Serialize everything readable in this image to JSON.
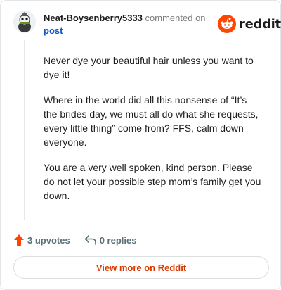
{
  "header": {
    "username": "Neat-Boysenberry5333",
    "commented_on": "commented on",
    "post_link": "post"
  },
  "brand": {
    "wordmark": "reddit",
    "color": "#ff4500"
  },
  "comment": {
    "paragraphs": [
      "Never dye your beautiful hair unless you want to dye it!",
      "Where in the world did all this nonsense of “It’s the brides day, we must all do what she requests, every little thing” come from? FFS, calm down everyone.",
      "You are a very well spoken, kind person. Please do not let your possible step mom’s family get you down."
    ]
  },
  "actions": {
    "upvotes_label": "3 upvotes",
    "replies_label": "0 replies"
  },
  "footer": {
    "view_more_label": "View more on Reddit"
  },
  "icons": {
    "avatar": "avatar",
    "brand": "reddit-snoo-icon",
    "upvote": "upvote-arrow-icon",
    "reply": "reply-arrow-icon"
  }
}
